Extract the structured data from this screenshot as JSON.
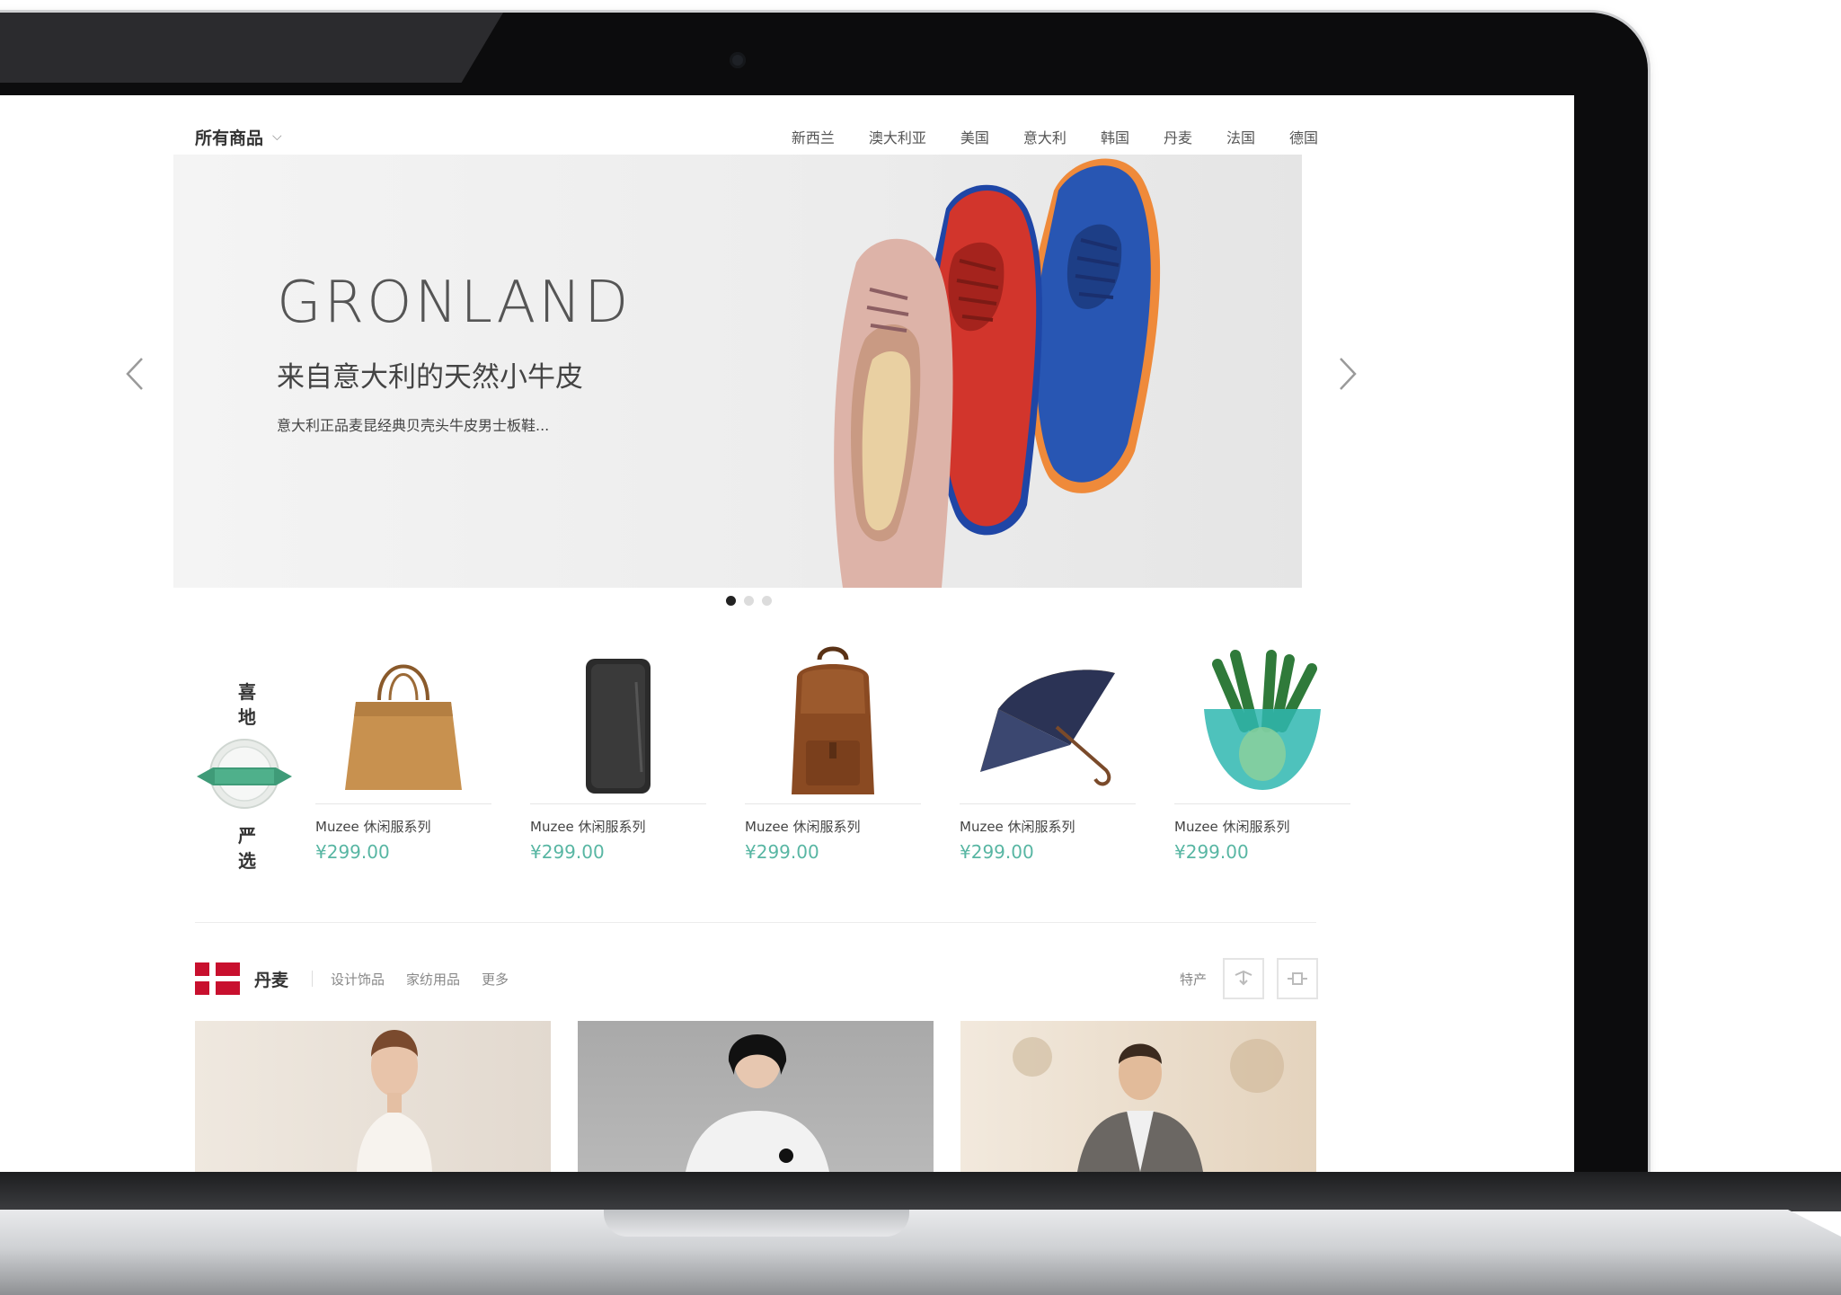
{
  "nav": {
    "category_label": "所有商品",
    "countries": [
      "新西兰",
      "澳大利亚",
      "美国",
      "意大利",
      "韩国",
      "丹麦",
      "法国",
      "德国"
    ]
  },
  "hero": {
    "title": "GRONLAND",
    "subtitle": "来自意大利的天然小牛皮",
    "description": "意大利正品麦昆经典贝壳头牛皮男士板鞋..."
  },
  "picks": {
    "label_chars": [
      "喜",
      "地",
      "严",
      "选"
    ],
    "products": [
      {
        "name": "Muzee 休闲服系列",
        "price": "¥299.00",
        "icon": "tote-bag"
      },
      {
        "name": "Muzee 休闲服系列",
        "price": "¥299.00",
        "icon": "phone-case"
      },
      {
        "name": "Muzee 休闲服系列",
        "price": "¥299.00",
        "icon": "backpack"
      },
      {
        "name": "Muzee 休闲服系列",
        "price": "¥299.00",
        "icon": "umbrella"
      },
      {
        "name": "Muzee 休闲服系列",
        "price": "¥299.00",
        "icon": "glass-bowl"
      }
    ]
  },
  "section": {
    "title": "丹麦",
    "links": [
      "设计饰品",
      "家纺用品",
      "更多"
    ],
    "special": "特产"
  },
  "colors": {
    "price": "#58b6a3",
    "flag_red": "#c8102e"
  }
}
